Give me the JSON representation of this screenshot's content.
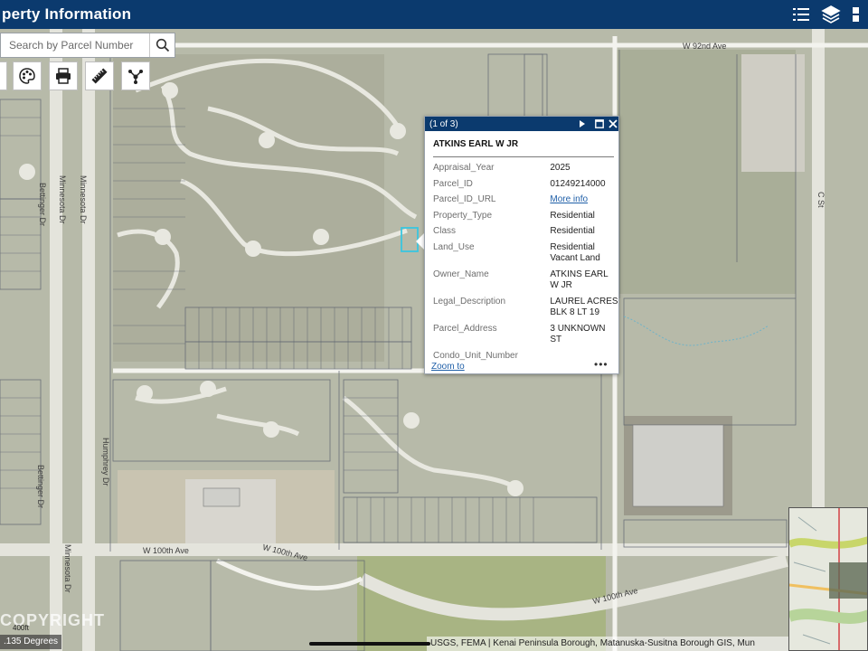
{
  "app": {
    "title": "perty Information"
  },
  "header_icons": [
    "list-icon",
    "layers-icon",
    "basemap-grid-icon"
  ],
  "search": {
    "placeholder": "Search by Parcel Number"
  },
  "tools": [
    "locate-icon",
    "palette-icon",
    "print-icon",
    "measure-ruler-icon",
    "share-icon"
  ],
  "map_labels": {
    "w92": "W 92nd Ave",
    "minnesota1": "Minnesota Dr",
    "minnesota2": "Minnesota Dr",
    "minnesota3": "Minnesota Dr",
    "bettinger1": "Bettinger Dr",
    "bettinger2": "Bettinger Dr",
    "humphrey": "Humphrey Dr",
    "cst": "C St",
    "w100a": "W 100th Ave",
    "w100b": "W 100th Ave",
    "w100c": "W 100th Ave"
  },
  "popup": {
    "counter": "(1 of 3)",
    "title": "ATKINS EARL W JR",
    "rows": [
      {
        "key": "Appraisal_Year",
        "value": "2025"
      },
      {
        "key": "Parcel_ID",
        "value": "01249214000"
      },
      {
        "key": "Parcel_ID_URL",
        "value": "More info"
      },
      {
        "key": "Property_Type",
        "value": "Residential"
      },
      {
        "key": "Class",
        "value": "Residential"
      },
      {
        "key": "Land_Use",
        "value": "Residential Vacant Land"
      },
      {
        "key": "Owner_Name",
        "value": "ATKINS EARL W JR"
      },
      {
        "key": "Legal_Description",
        "value": "LAUREL ACRES BLK 8 LT 19"
      },
      {
        "key": "Parcel_Address",
        "value": "3 UNKNOWN ST"
      },
      {
        "key": "Condo_Unit_Number",
        "value": ""
      }
    ],
    "zoom_label": "Zoom to",
    "more_label": "•••"
  },
  "footer": {
    "copyright": "COPYRIGHT",
    "scale": ".135 Degrees",
    "ft": "400ft",
    "attribution": "USGS, FEMA | Kenai Peninsula Borough, Matanuska-Susitna Borough GIS, Mun"
  },
  "colors": {
    "header": "#0b3a6e",
    "map_bg": "#b9bcae",
    "road": "#e8e8e2",
    "parcel_line": "#5f6570",
    "selected_parcel": "#39c6e0",
    "link": "#1f5fa8"
  }
}
